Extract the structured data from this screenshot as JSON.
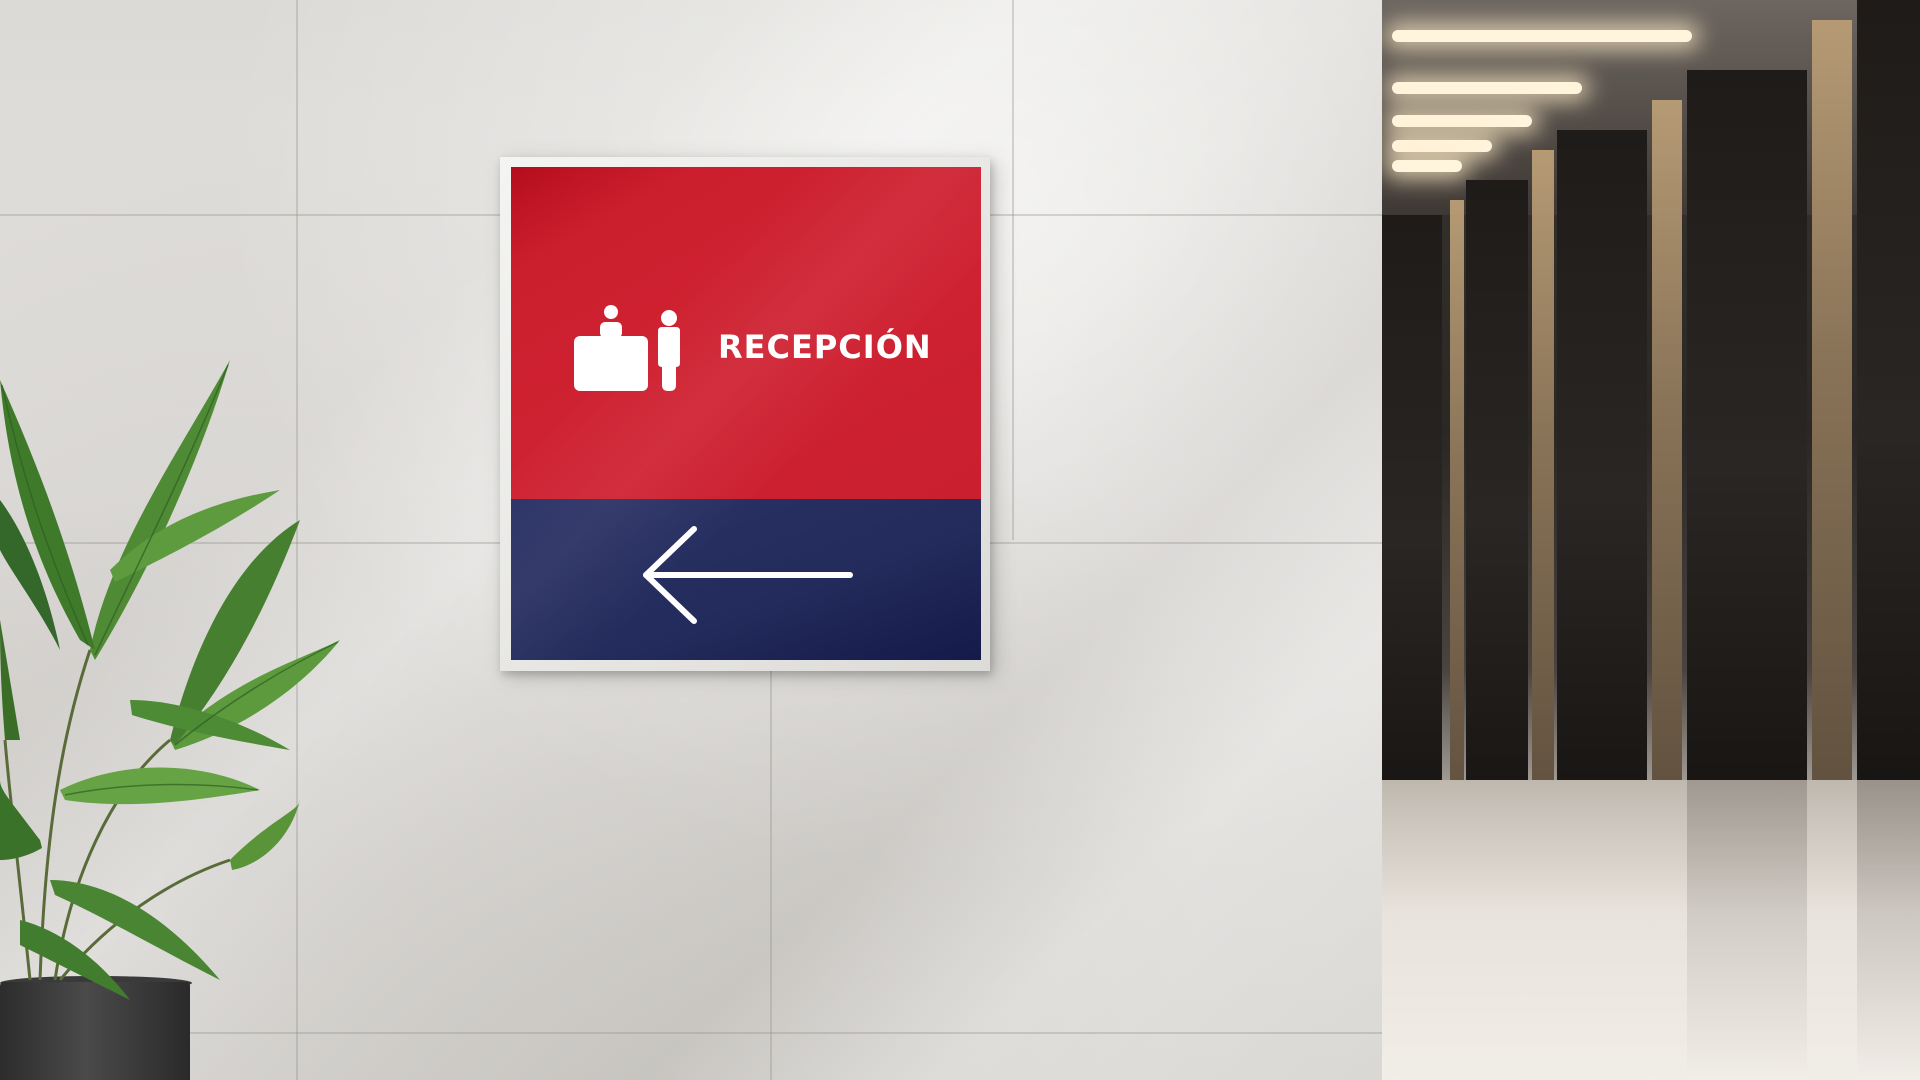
{
  "sign": {
    "label": "RECEPCIÓN",
    "icon": "reception-desk-icon",
    "direction_icon": "arrow-left-icon",
    "colors": {
      "top_panel": "#cf2232",
      "bottom_panel": "#232b5c",
      "frame": "#ebeae7",
      "foreground": "#ffffff"
    }
  },
  "scene": {
    "wall_color": "#dedcd8",
    "corridor_color": "#2b2724",
    "plant_color": "#4f8a35",
    "pot_color": "#333333"
  }
}
